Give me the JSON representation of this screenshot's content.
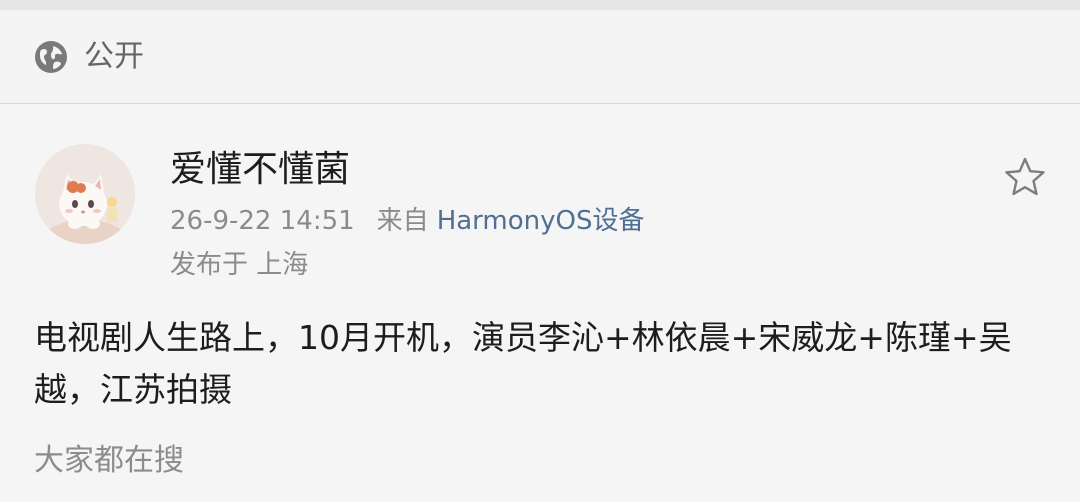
{
  "visibility": {
    "icon": "globe-icon",
    "label": "公开"
  },
  "post": {
    "avatar_icon": "cat-avatar",
    "username": "爱懂不懂菌",
    "timestamp": "26-9-22 14:51",
    "source_prefix": "来自",
    "source_name": "HarmonyOS设备",
    "location": "发布于 上海",
    "favorite_icon": "star-icon",
    "body": "电视剧人生路上，10月开机，演员李沁+林依晨+宋威龙+陈瑾+吴越，江苏拍摄"
  },
  "trending": {
    "label": "大家都在搜"
  },
  "colors": {
    "link": "#4f6f94",
    "muted": "#8b8b8b",
    "text": "#1d1d1d",
    "background": "#f5f5f5"
  }
}
